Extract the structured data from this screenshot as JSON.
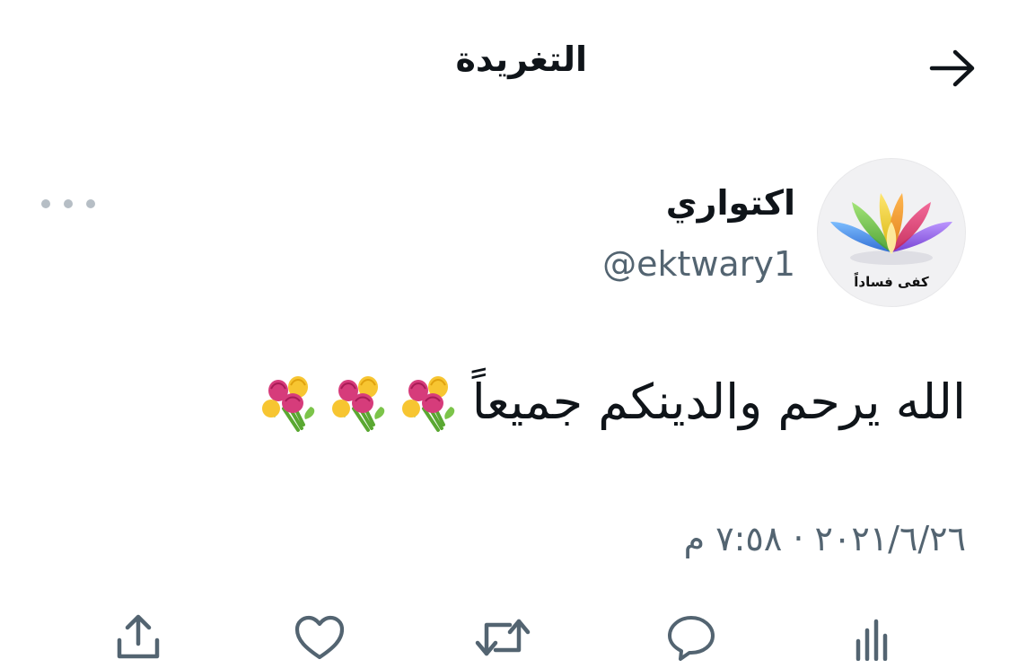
{
  "header": {
    "title": "التغريدة",
    "back_icon": "arrow-right-icon"
  },
  "author": {
    "display_name": "اكتواري",
    "handle": "@ektwary1",
    "avatar_caption": "كفى فساداً",
    "more_icon": "more-dots-icon"
  },
  "tweet": {
    "text": "الله يرحم والدينكم جميعاً",
    "emoji_name": "bouquet-emoji",
    "emoji_count": 3,
    "timestamp": "٢٠٢١/٦/٢٦ · ٧:٥٨ م"
  },
  "actions": {
    "items": [
      "analytics-icon",
      "reply-icon",
      "retweet-icon",
      "like-icon",
      "share-icon"
    ]
  },
  "colors": {
    "text_primary": "#0f1419",
    "text_secondary": "#536471",
    "icon": "#536471",
    "more_dots": "#b6bec5"
  }
}
